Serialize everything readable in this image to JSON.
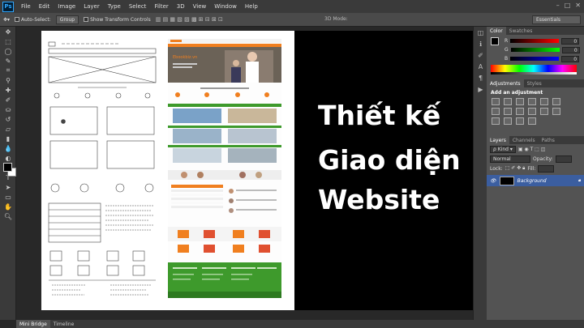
{
  "app": {
    "logo": "Ps"
  },
  "menu": [
    "File",
    "Edit",
    "Image",
    "Layer",
    "Type",
    "Select",
    "Filter",
    "3D",
    "View",
    "Window",
    "Help"
  ],
  "options": {
    "auto_select_label": "Auto-Select:",
    "auto_select_value": "Group",
    "transform_label": "Show Transform Controls",
    "mode_3d": "3D Mode:",
    "workspace": "Essentials"
  },
  "canvas": {
    "title_lines": [
      "Thiết kế",
      "Giao diện",
      "Website"
    ],
    "site_banner": "Ebookbiz.vn"
  },
  "panels": {
    "color_tabs": [
      "Color",
      "Swatches"
    ],
    "color_channels": [
      {
        "label": "R",
        "value": "0"
      },
      {
        "label": "G",
        "value": "0"
      },
      {
        "label": "B",
        "value": "0"
      }
    ],
    "adjust_tabs": [
      "Adjustments",
      "Styles"
    ],
    "adjust_title": "Add an adjustment",
    "layers_tabs": [
      "Layers",
      "Channels",
      "Paths"
    ],
    "kind_label": "Kind",
    "blend_mode": "Normal",
    "opacity_label": "Opacity:",
    "lock_label": "Lock:",
    "fill_label": "Fill:",
    "layer_name": "Background"
  },
  "bottom_tabs": [
    "Mini Bridge",
    "Timeline"
  ],
  "colors": {
    "accent": "#f07f1f",
    "green": "#3e9a2c",
    "selection": "#3b5ea0"
  }
}
